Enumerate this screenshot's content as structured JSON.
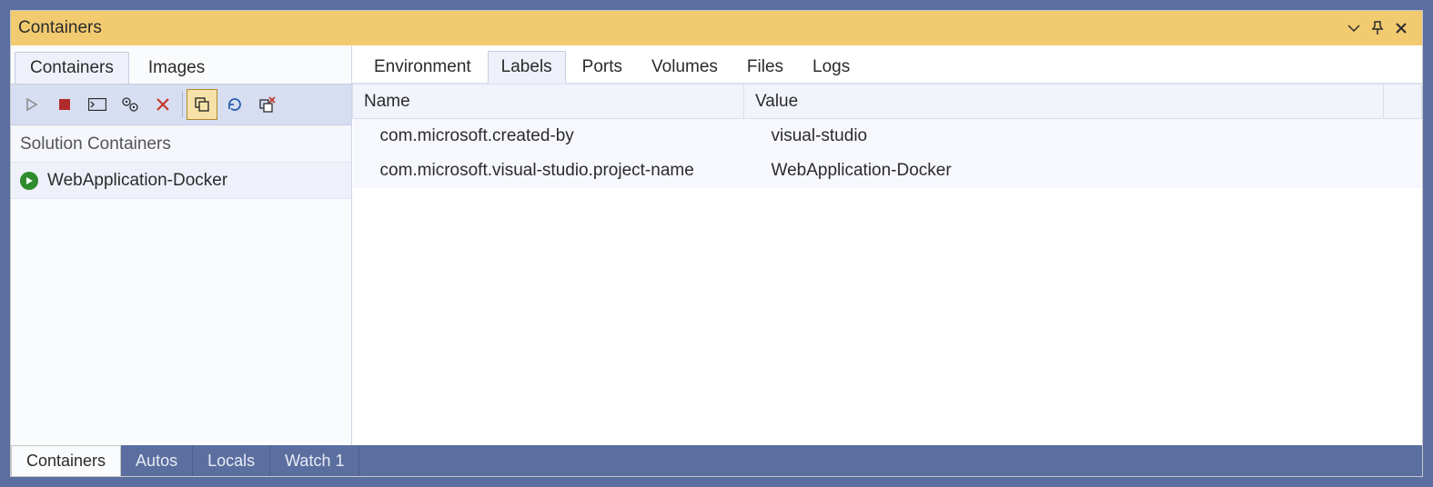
{
  "titlebar": {
    "title": "Containers"
  },
  "left_tabs": {
    "containers": "Containers",
    "images": "Images",
    "active": "containers"
  },
  "toolbar_icons": {
    "start": "start-icon",
    "stop": "stop-icon",
    "terminal": "terminal-icon",
    "settings": "settings-gear-icon",
    "delete": "delete-x-icon",
    "copy": "copy-icon",
    "refresh": "refresh-icon",
    "remove": "remove-container-icon"
  },
  "section_header": "Solution Containers",
  "containers": {
    "items": [
      {
        "name": "WebApplication-Docker",
        "running": true
      }
    ]
  },
  "detail_tabs": {
    "environment": "Environment",
    "labels": "Labels",
    "ports": "Ports",
    "volumes": "Volumes",
    "files": "Files",
    "logs": "Logs",
    "active": "labels"
  },
  "labels_table": {
    "columns": {
      "name": "Name",
      "value": "Value"
    },
    "rows": [
      {
        "name": "com.microsoft.created-by",
        "value": "visual-studio"
      },
      {
        "name": "com.microsoft.visual-studio.project-name",
        "value": "WebApplication-Docker"
      }
    ]
  },
  "bottom_tabs": {
    "containers": "Containers",
    "autos": "Autos",
    "locals": "Locals",
    "watch1": "Watch 1",
    "active": "containers"
  }
}
